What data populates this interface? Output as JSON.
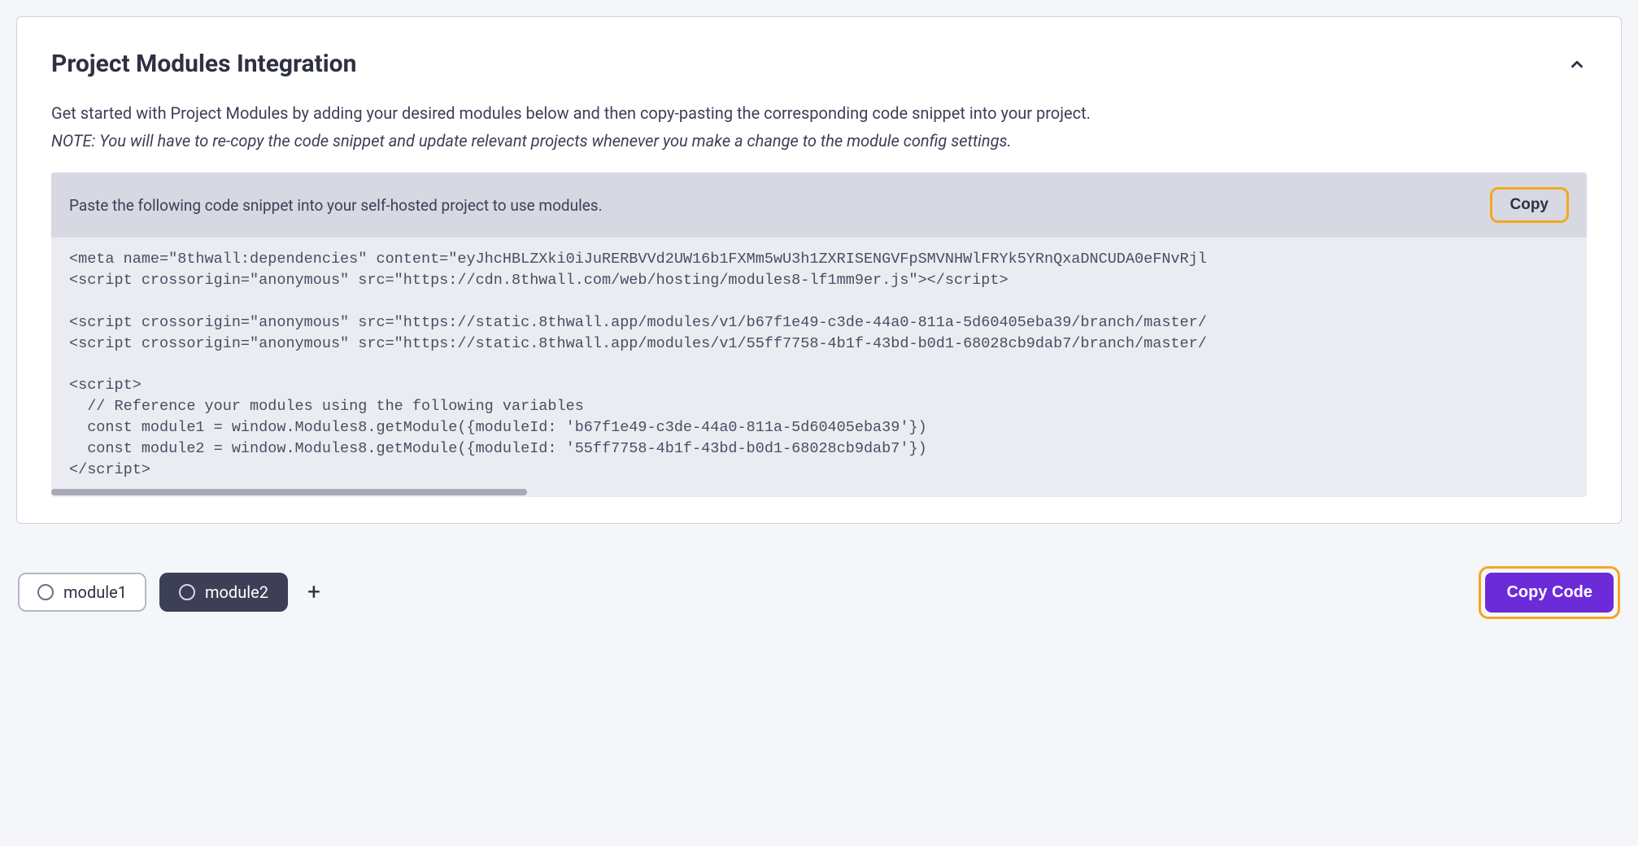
{
  "panel": {
    "title": "Project Modules Integration",
    "intro": "Get started with Project Modules by adding your desired modules below and then copy-pasting the corresponding code snippet into your project.",
    "note": "NOTE: You will have to re-copy the code snippet and update relevant projects whenever you make a change to the module config settings."
  },
  "codeBlock": {
    "headerText": "Paste the following code snippet into your self-hosted project to use modules.",
    "copyLabel": "Copy",
    "lines": {
      "l1": "<meta name=\"8thwall:dependencies\" content=\"eyJhcHBLZXki0iJuRERBVVd2UW16b1FXMm5wU3h1ZXRISENGVFpSMVNHWlFRYk5YRnQxaDNCUDA0eFNvRjl",
      "l2": "<script crossorigin=\"anonymous\" src=\"https://cdn.8thwall.com/web/hosting/modules8-lf1mm9er.js\"></scr",
      "l3": "",
      "l4": "<script crossorigin=\"anonymous\" src=\"https://static.8thwall.app/modules/v1/b67f1e49-c3de-44a0-811a-5d60405eba39/branch/master/",
      "l5": "<script crossorigin=\"anonymous\" src=\"https://static.8thwall.app/modules/v1/55ff7758-4b1f-43bd-b0d1-68028cb9dab7/branch/master/",
      "l6": "",
      "l7": "<scr",
      "l8": "  // Reference your modules using the following variables",
      "l9": "  const module1 = window.Modules8.getModule({moduleId: 'b67f1e49-c3de-44a0-811a-5d60405eba39'})",
      "l10": "  const module2 = window.Modules8.getModule({moduleId: '55ff7758-4b1f-43bd-b0d1-68028cb9dab7'})",
      "l11": "</scr"
    }
  },
  "bottomBar": {
    "module1": "module1",
    "module2": "module2",
    "addIcon": "+",
    "copyCodeLabel": "Copy Code"
  }
}
